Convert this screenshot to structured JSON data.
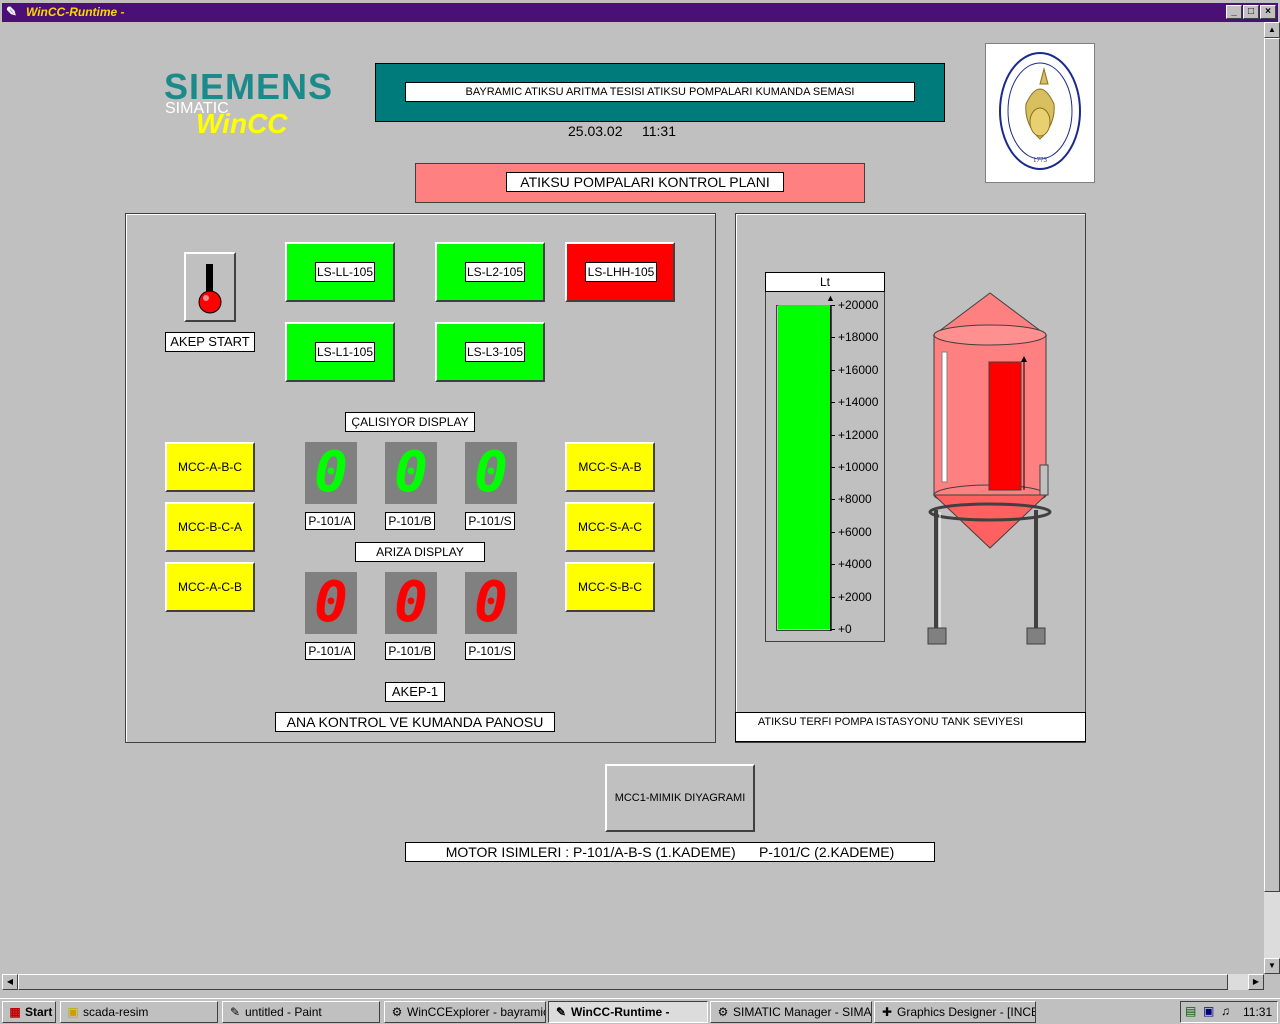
{
  "window": {
    "title": "WinCC-Runtime -"
  },
  "branding": {
    "siemens": "SIEMENS",
    "simatic": "SIMATIC",
    "wincc": "WinCC"
  },
  "header": {
    "title": "BAYRAMIC ATIKSU ARITMA TESISI ATIKSU POMPALARI KUMANDA SEMASI",
    "date": "25.03.02",
    "time": "11:31",
    "plan_title": "ATIKSU POMPALARI KONTROL PLANI"
  },
  "logo": {
    "top_text": "İSTANBUL TEKNİK ÜNİVERSİTESİ",
    "year": "1773"
  },
  "control_panel": {
    "start_label": "AKEP START",
    "sensors": [
      {
        "label": "LS-LL-105",
        "color": "#00ff00"
      },
      {
        "label": "LS-L2-105",
        "color": "#00ff00"
      },
      {
        "label": "LS-LHH-105",
        "color": "#ff0000"
      },
      {
        "label": "LS-L1-105",
        "color": "#00ff00"
      },
      {
        "label": "LS-L3-105",
        "color": "#00ff00"
      }
    ],
    "running_display_label": "ÇALISIYOR DISPLAY",
    "fault_display_label": "ARIZA DISPLAY",
    "running_digits": [
      "0",
      "0",
      "0"
    ],
    "fault_digits": [
      "0",
      "0",
      "0"
    ],
    "running_pumps": [
      "P-101/A",
      "P-101/B",
      "P-101/S"
    ],
    "fault_pumps": [
      "P-101/A",
      "P-101/B",
      "P-101/S"
    ],
    "mcc_left": [
      "MCC-A-B-C",
      "MCC-B-C-A",
      "MCC-A-C-B"
    ],
    "mcc_right": [
      "MCC-S-A-B",
      "MCC-S-A-C",
      "MCC-S-B-C"
    ],
    "akep_label": "AKEP-1",
    "panel_title": "ANA KONTROL VE KUMANDA PANOSU"
  },
  "tank_panel": {
    "unit": "Lt",
    "scale_ticks": [
      "+20000",
      "+18000",
      "+16000",
      "+14000",
      "+12000",
      "+10000",
      "+8000",
      "+6000",
      "+4000",
      "+2000",
      "+0"
    ],
    "level_fraction": 1.0,
    "title": "ATIKSU TERFI POMPA ISTASYONU TANK SEVIYESI"
  },
  "mimic_button": "MCC1-MIMIK DIYAGRAMI",
  "motor_names": "MOTOR ISIMLERI : P-101/A-B-S (1.KADEME)      P-101/C (2.KADEME)",
  "colors": {
    "green": "#00ff00",
    "red": "#ff0000",
    "yellow": "#ffff00",
    "teal": "#007b7b",
    "salmon": "#ff8080",
    "title_bar": "#4b1078"
  },
  "taskbar": {
    "start": "Start",
    "items": [
      {
        "label": "scada-resim",
        "icon": "folder-icon"
      },
      {
        "label": "untitled - Paint",
        "icon": "paint-icon"
      },
      {
        "label": "WinCCExplorer - bayramic ...",
        "icon": "wincc-icon"
      },
      {
        "label": "WinCC-Runtime -",
        "icon": "wincc-runtime-icon"
      },
      {
        "label": "SIMATIC Manager - SIMA...",
        "icon": "simatic-icon"
      },
      {
        "label": "Graphics Designer - [INCE ...",
        "icon": "designer-icon"
      }
    ],
    "clock": "11:31"
  }
}
